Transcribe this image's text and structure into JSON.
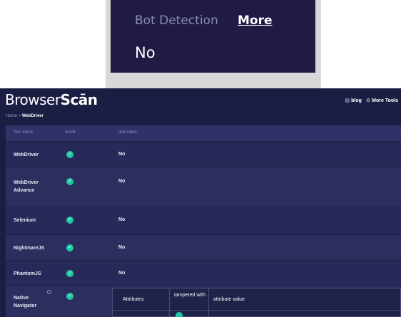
{
  "card": {
    "title": "Bot Detection",
    "more": "More",
    "value": "No"
  },
  "app": {
    "logo_plain": "Browser",
    "logo_bold": "Scān",
    "breadcrumb": {
      "home": "Home",
      "separator": ">",
      "current": "WebDriver"
    },
    "nav": {
      "blog": "blog",
      "more_tools": "More Tools"
    }
  },
  "table": {
    "headers": {
      "items": "Test items",
      "result": "result",
      "value": "test value"
    },
    "rows": [
      {
        "name": "WebDriver",
        "value": "No"
      },
      {
        "name": "WebDriver Advance",
        "value": "No"
      },
      {
        "name": "Selenium",
        "value": "No"
      },
      {
        "name": "NightmareJS",
        "value": "No"
      },
      {
        "name": "PhantomJS",
        "value": "No"
      },
      {
        "name": "Native Navigator",
        "value": ""
      }
    ],
    "sub_headers": {
      "attributes": "Attributes",
      "tampered": "tampered with",
      "attribute_value": "attribute value"
    }
  },
  "colors": {
    "accent": "#1ec9a1",
    "background": "#1b1e43",
    "card": "#1f1b45"
  }
}
